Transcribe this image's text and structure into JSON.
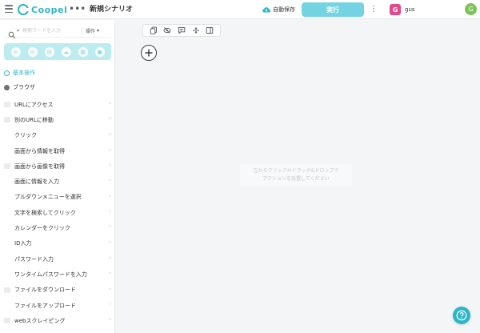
{
  "header": {
    "logo_text": "Coopel",
    "more_label": "•••",
    "separator": "›",
    "scenario_title": "新規シナリオ",
    "autosave_label": "自動保存",
    "run_button_label": "実行",
    "more_vertical": "⋮",
    "workspace_initial": "G",
    "workspace_name": "gus",
    "user_initial": "G"
  },
  "sidebar": {
    "search_placeholder": "検索ワードを入力",
    "search_scope": "操作",
    "category_icons": [
      "all-icon",
      "browser-icon",
      "file-icon",
      "cloud-icon",
      "spreadsheet-icon",
      "user-icon"
    ],
    "groups": [
      {
        "label": "基本操作",
        "active": true
      },
      {
        "label": "ブラウザ",
        "active": false
      }
    ],
    "actions": [
      {
        "label": "URLにアクセス"
      },
      {
        "label": "別のURLに移動"
      },
      {
        "label": "クリック"
      },
      {
        "label": "画面から情報を取得"
      },
      {
        "label": "画面から画像を取得"
      },
      {
        "label": "画面に情報を入力"
      },
      {
        "label": "プルダウンメニューを選択"
      },
      {
        "label": "文字を検索してクリック"
      },
      {
        "label": "カレンダーをクリック"
      },
      {
        "label": "ID入力"
      },
      {
        "label": "パスワード入力"
      },
      {
        "label": "ワンタイムパスワードを入力"
      },
      {
        "label": "ファイルをダウンロード"
      },
      {
        "label": "ファイルをアップロード"
      },
      {
        "label": "webスクレイピング"
      }
    ]
  },
  "canvas": {
    "toolbar_icons": [
      "copy-icon",
      "hide-icon",
      "comment-icon",
      "split-icon",
      "panel-icon"
    ],
    "empty_hint_line1": "左からクリックかドラッグ&ドロップで",
    "empty_hint_line2": "アクションを設置してください"
  },
  "colors": {
    "accent": "#2cb5c9",
    "run_button": "#74d3e2",
    "category_bar": "#bcebf0",
    "workspace_badge": "#e2478a",
    "user_avatar": "#7cc35b"
  }
}
